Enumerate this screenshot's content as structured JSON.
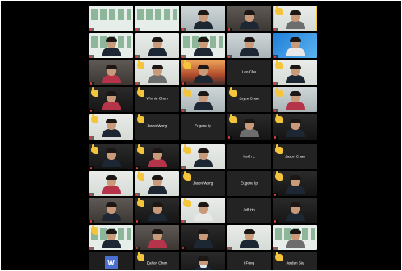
{
  "page1": [
    {
      "name": "",
      "style": "banner",
      "person": false
    },
    {
      "name": "",
      "style": "banner",
      "person": false
    },
    {
      "name": "",
      "style": "office",
      "person": true,
      "shirt": "dark"
    },
    {
      "name": "",
      "style": "room",
      "person": true,
      "shirt": "dark"
    },
    {
      "name": "",
      "style": "light",
      "person": true,
      "shirt": "grey",
      "hand": true,
      "speaking": true
    },
    {
      "name": "",
      "style": "banner",
      "person": true,
      "shirt": "dark"
    },
    {
      "name": "",
      "style": "light",
      "person": true,
      "shirt": "dark"
    },
    {
      "name": "",
      "style": "banner",
      "person": true,
      "shirt": "dark"
    },
    {
      "name": "",
      "style": "office",
      "person": true,
      "shirt": "dark"
    },
    {
      "name": "",
      "style": "blue",
      "person": true,
      "shirt": "white"
    },
    {
      "name": "",
      "style": "room",
      "person": true,
      "shirt": "red"
    },
    {
      "name": "",
      "style": "light",
      "person": true,
      "shirt": "grey",
      "hand": true
    },
    {
      "name": "",
      "style": "sunset",
      "person": true,
      "shirt": "dark",
      "hand": true
    },
    {
      "name": "Leo Chu",
      "style": "text"
    },
    {
      "name": "",
      "style": "light",
      "person": true,
      "shirt": "dark",
      "hand": true
    },
    {
      "name": "",
      "style": "dark",
      "person": true,
      "shirt": "red",
      "hand": true
    },
    {
      "name": "Winnie Chan",
      "style": "text",
      "hand": true
    },
    {
      "name": "",
      "style": "office",
      "person": true,
      "shirt": "dark",
      "hand": true
    },
    {
      "name": "Joyce Chan",
      "style": "text",
      "hand": true
    },
    {
      "name": "",
      "style": "office",
      "person": true,
      "shirt": "red",
      "hand": true
    },
    {
      "name": "",
      "style": "light",
      "person": true,
      "shirt": "dark",
      "hand": true
    },
    {
      "name": "Jason Wong",
      "style": "text",
      "hand": true
    },
    {
      "name": "Eugene Ip",
      "style": "text"
    },
    {
      "name": "",
      "style": "dark",
      "person": true,
      "shirt": "grey",
      "hand": true
    },
    {
      "name": "",
      "style": "dark",
      "person": true,
      "shirt": "dark",
      "hand": true
    },
    {
      "name": "",
      "style": "banner",
      "person": true,
      "shirt": "white"
    }
  ],
  "page2": [
    {
      "name": "",
      "style": "dark",
      "person": true,
      "shirt": "dark",
      "hand": true
    },
    {
      "name": "",
      "style": "dark",
      "person": true,
      "shirt": "red",
      "hand": true
    },
    {
      "name": "",
      "style": "light",
      "person": true,
      "shirt": "dark",
      "hand": true
    },
    {
      "name": "Keith L",
      "style": "text"
    },
    {
      "name": "Jason Chan",
      "style": "text",
      "hand": true
    },
    {
      "name": "",
      "style": "light",
      "person": true,
      "shirt": "red"
    },
    {
      "name": "",
      "style": "light",
      "person": true,
      "shirt": "dark",
      "hand": true
    },
    {
      "name": "Jason Wong",
      "style": "text",
      "hand": true
    },
    {
      "name": "Eugene Ip",
      "style": "text"
    },
    {
      "name": "",
      "style": "dark",
      "person": true,
      "shirt": "dark",
      "hand": true
    },
    {
      "name": "",
      "style": "room",
      "person": true,
      "shirt": "dark"
    },
    {
      "name": "",
      "style": "dark",
      "person": true,
      "shirt": "dark",
      "hand": true
    },
    {
      "name": "",
      "style": "light",
      "person": true,
      "shirt": "white",
      "hand": true
    },
    {
      "name": "Jeff Ho",
      "style": "text"
    },
    {
      "name": "",
      "style": "dark",
      "person": true,
      "shirt": "dark"
    },
    {
      "name": "",
      "style": "banner",
      "person": true,
      "shirt": "dark",
      "hand": true
    },
    {
      "name": "",
      "style": "room",
      "person": true,
      "shirt": "red"
    },
    {
      "name": "",
      "style": "dark",
      "person": true,
      "shirt": "dark"
    },
    {
      "name": "",
      "style": "light",
      "person": true,
      "shirt": "dark"
    },
    {
      "name": "",
      "style": "banner",
      "person": true,
      "shirt": "grey"
    },
    {
      "name": "",
      "style": "avatar",
      "avatar_letter": "W"
    },
    {
      "name": "Dalton Chan",
      "style": "text",
      "hand": true
    },
    {
      "name": "",
      "style": "dark",
      "person": true,
      "shirt": "dark",
      "mask": true
    },
    {
      "name": "I Fung",
      "style": "text"
    },
    {
      "name": "Jordan Siu",
      "style": "text",
      "hand": true
    }
  ]
}
